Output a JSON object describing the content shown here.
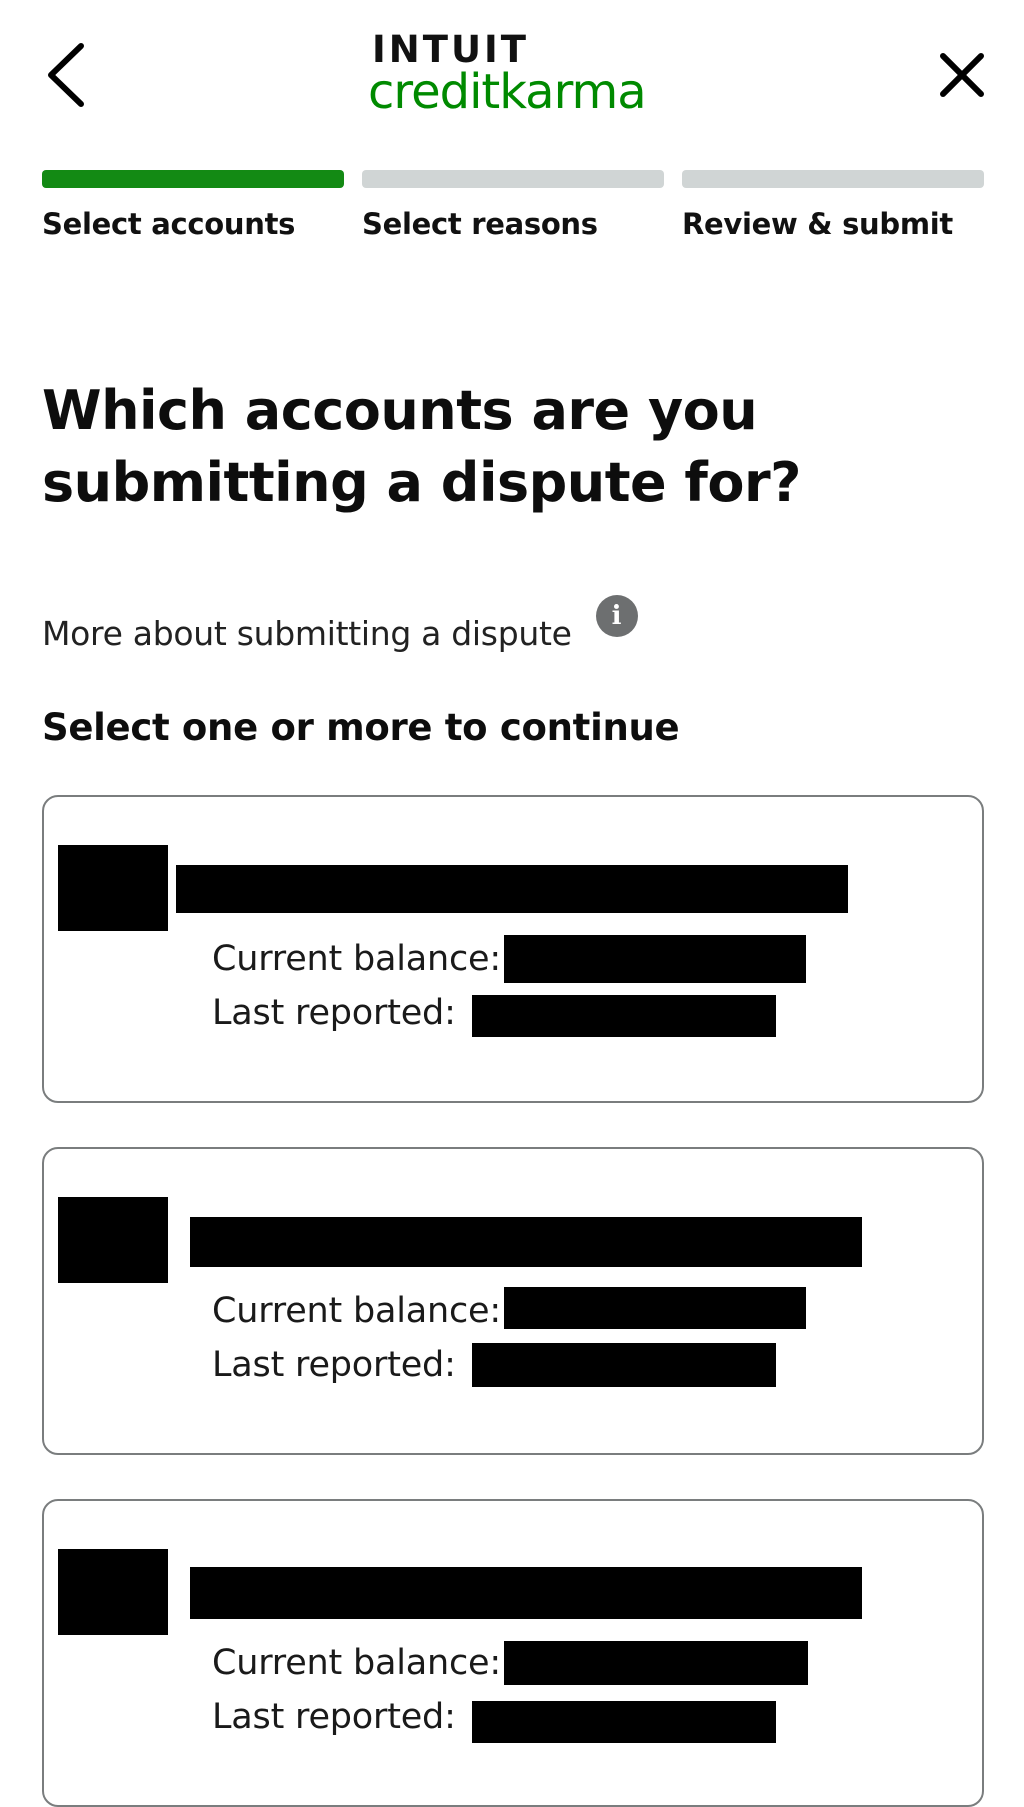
{
  "header": {
    "back_icon": "chevron-left-icon",
    "close_icon": "close-icon",
    "logo": {
      "top_text": "INTUIT",
      "bottom_text": "creditkarma",
      "color": "#008a00"
    }
  },
  "progress": {
    "steps": [
      {
        "label": "Select accounts",
        "active": true
      },
      {
        "label": "Select reasons",
        "active": false
      },
      {
        "label": "Review & submit",
        "active": false
      }
    ],
    "active_color": "#138a14",
    "inactive_color": "#d0d5d5"
  },
  "title": "Which accounts are you submitting a dispute for?",
  "more_info": {
    "text": "More about submitting a dispute",
    "icon": "info-icon"
  },
  "select_prompt": "Select one or more to continue",
  "accounts": [
    {
      "balance_label": "Current balance:",
      "reported_label": "Last reported:"
    },
    {
      "balance_label": "Current balance:",
      "reported_label": "Last reported:"
    },
    {
      "balance_label": "Current balance:",
      "reported_label": "Last reported:"
    }
  ]
}
